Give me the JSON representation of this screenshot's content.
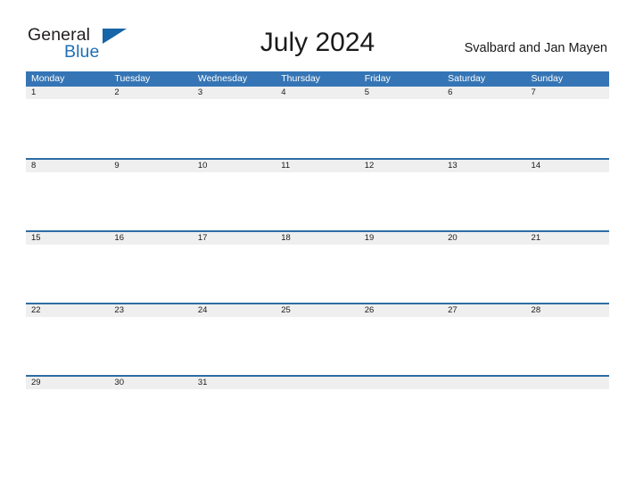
{
  "brand": {
    "name_part1": "General",
    "name_part2": "Blue",
    "flag_icon": "blue-triangle-flag",
    "color_dark": "#231f20",
    "color_blue": "#1f6fb5"
  },
  "header": {
    "title": "July 2024",
    "region": "Svalbard and Jan Mayen"
  },
  "calendar": {
    "accent_color": "#3575b5",
    "row_separator_color": "#2e6da4",
    "date_band_color": "#efefef",
    "weekdays": [
      "Monday",
      "Tuesday",
      "Wednesday",
      "Thursday",
      "Friday",
      "Saturday",
      "Sunday"
    ],
    "weeks": [
      {
        "days": [
          "1",
          "2",
          "3",
          "4",
          "5",
          "6",
          "7"
        ]
      },
      {
        "days": [
          "8",
          "9",
          "10",
          "11",
          "12",
          "13",
          "14"
        ]
      },
      {
        "days": [
          "15",
          "16",
          "17",
          "18",
          "19",
          "20",
          "21"
        ]
      },
      {
        "days": [
          "22",
          "23",
          "24",
          "25",
          "26",
          "27",
          "28"
        ]
      },
      {
        "days": [
          "29",
          "30",
          "31",
          "",
          "",
          "",
          ""
        ]
      }
    ]
  }
}
